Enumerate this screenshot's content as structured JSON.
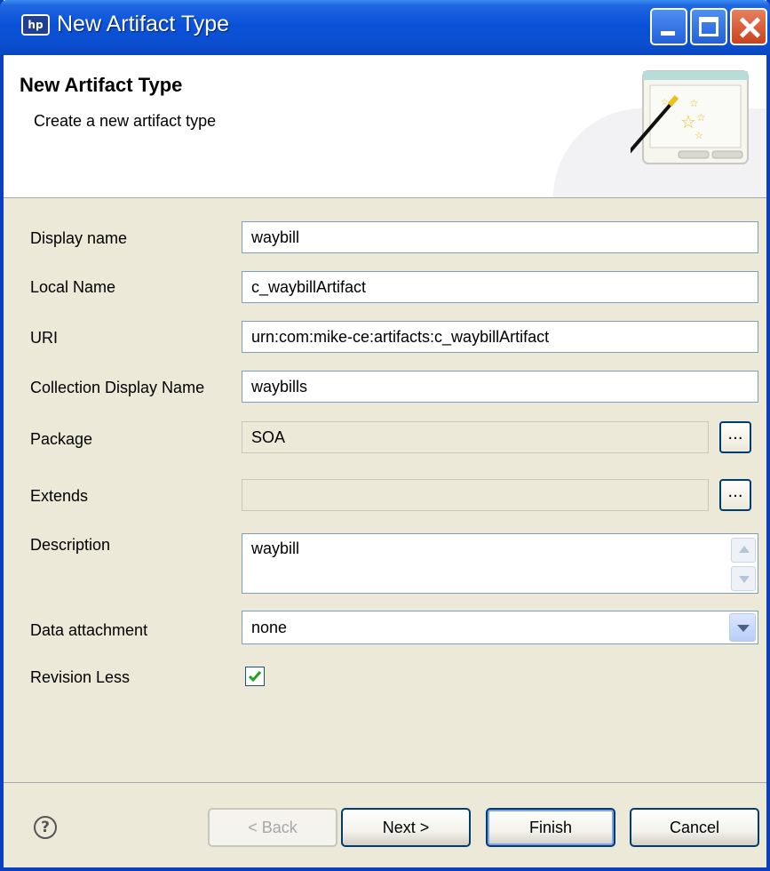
{
  "window": {
    "title": "New Artifact Type",
    "app_icon": "hp"
  },
  "header": {
    "title": "New Artifact Type",
    "subtitle": "Create a new artifact type"
  },
  "form": {
    "display_name": {
      "label": "Display name",
      "value": "waybill"
    },
    "local_name": {
      "label": "Local Name",
      "value": "c_waybillArtifact"
    },
    "uri": {
      "label": "URI",
      "value": "urn:com:mike-ce:artifacts:c_waybillArtifact"
    },
    "collection_display_name": {
      "label": "Collection Display Name",
      "value": "waybills"
    },
    "package": {
      "label": "Package",
      "value": "SOA",
      "browse_label": "..."
    },
    "extends": {
      "label": "Extends",
      "value": "",
      "browse_label": "..."
    },
    "description": {
      "label": "Description",
      "value": "waybill"
    },
    "data_attachment": {
      "label": "Data attachment",
      "value": "none"
    },
    "revision_less": {
      "label": "Revision Less",
      "checked": true
    }
  },
  "footer": {
    "help_label": "?",
    "back_label": "< Back",
    "next_label": "Next >",
    "finish_label": "Finish",
    "cancel_label": "Cancel"
  }
}
